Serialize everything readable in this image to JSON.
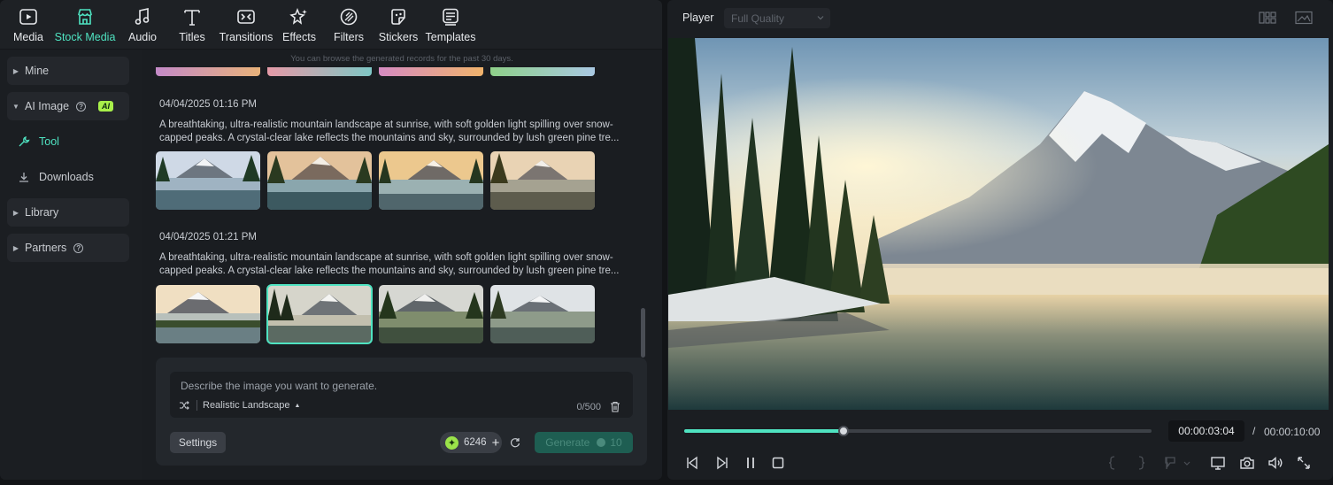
{
  "toolbar": {
    "tabs": [
      {
        "label": "Media",
        "icon": "media-icon"
      },
      {
        "label": "Stock Media",
        "icon": "stock-media-icon"
      },
      {
        "label": "Audio",
        "icon": "audio-icon"
      },
      {
        "label": "Titles",
        "icon": "titles-icon"
      },
      {
        "label": "Transitions",
        "icon": "transitions-icon"
      },
      {
        "label": "Effects",
        "icon": "effects-icon"
      },
      {
        "label": "Filters",
        "icon": "filters-icon"
      },
      {
        "label": "Stickers",
        "icon": "stickers-icon"
      },
      {
        "label": "Templates",
        "icon": "templates-icon"
      }
    ],
    "active": "Stock Media"
  },
  "sidebar": {
    "mine": "Mine",
    "ai_image": "AI Image",
    "ai_badge": "AI",
    "tool": "Tool",
    "downloads": "Downloads",
    "library": "Library",
    "partners": "Partners"
  },
  "history": {
    "hint": "You can browse the generated records for the past 30 days.",
    "records": [
      {
        "date": "04/04/2025 01:16 PM",
        "prompt_line1": "A breathtaking, ultra-realistic mountain landscape at sunrise, with soft golden light spilling over snow-",
        "prompt_line2": "capped peaks. A crystal-clear lake reflects the mountains and sky, surrounded by lush green pine tre..."
      },
      {
        "date": "04/04/2025 01:21 PM",
        "prompt_line1": "A breathtaking, ultra-realistic mountain landscape at sunrise, with soft golden light spilling over snow-",
        "prompt_line2": "capped peaks. A crystal-clear lake reflects the mountains and sky, surrounded by lush green pine tre..."
      }
    ]
  },
  "generator": {
    "placeholder": "Describe the image you want to generate.",
    "style": "Realistic Landscape",
    "counter": "0/500",
    "settings": "Settings",
    "credits": "6246",
    "generate": "Generate",
    "generate_cost": "10"
  },
  "player": {
    "title": "Player",
    "quality": "Full Quality",
    "current_time": "00:00:03:04",
    "separator": "/",
    "total_time": "00:00:10:00",
    "progress": 0.34
  },
  "colors": {
    "accent": "#4fe3c1",
    "ai_badge": "#a8f04a",
    "credits": "#9be34a"
  }
}
